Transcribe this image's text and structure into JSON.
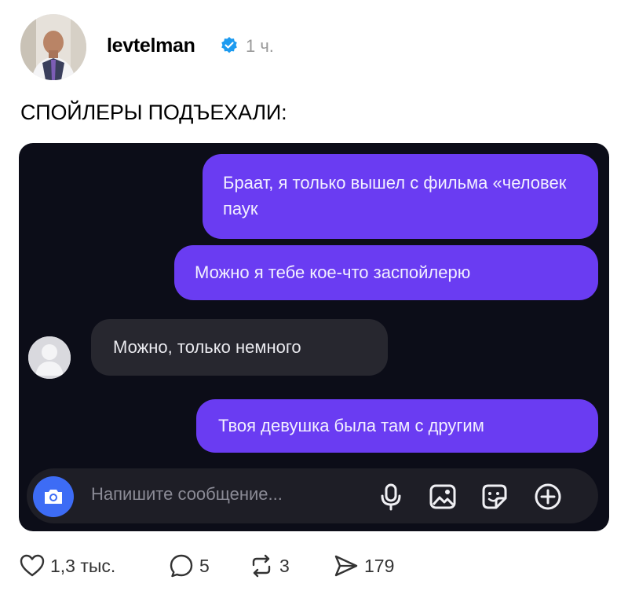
{
  "post": {
    "username": "levtelman",
    "time": "1 ч.",
    "caption": "СПОЙЛЕРЫ ПОДЪЕХАЛИ:",
    "verified_color": "#1d9bf0"
  },
  "chat": {
    "messages": [
      {
        "side": "out",
        "text": "Браат, я только вышел с фильма «человек паук"
      },
      {
        "side": "out",
        "text": "Можно я тебе кое-что заспойлерю"
      },
      {
        "side": "in",
        "text": "Можно, только немного"
      },
      {
        "side": "out",
        "text": "Твоя девушка была там с другим"
      }
    ],
    "composer_placeholder": "Напишите сообщение...",
    "accent_out": "#6a3cf2",
    "accent_camera": "#3d6cf5"
  },
  "actions": {
    "likes": "1,3 тыс.",
    "replies": "5",
    "reposts": "3",
    "shares": "179"
  }
}
